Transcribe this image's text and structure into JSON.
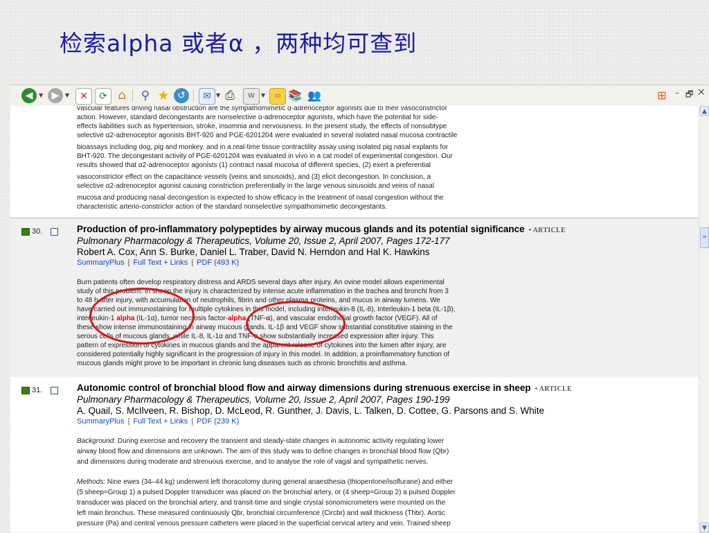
{
  "slide_title": "检索alpha 或者α ，两种均可查到",
  "toolbar": {
    "icons": [
      "back-icon",
      "forward-icon",
      "stop-icon",
      "refresh-icon",
      "home-icon",
      "search-icon",
      "favorites-icon",
      "history-icon",
      "mail-icon",
      "print-icon",
      "edit-icon",
      "discuss-icon",
      "research-icon",
      "messenger-icon"
    ],
    "window_controls": {
      "minimize": "–",
      "restore": "🗗",
      "close": "×"
    }
  },
  "prev_abstract_lines": [
    "vascular features driving nasal obstruction are the sympathomimetic α-adrenoceptor agonists due to their vasoconstrictor",
    "action. However, standard decongestants are nonselective α-adrenoceptor agonists, which have the potential for side-",
    "effects liabilities such as hypertension, stroke, insomnia and nervousness. In the present study, the effects of nonsubtype",
    "selective α2-adrenoceptor agonists BHT-920 and PGE-6201204 were evaluated in several isolated nasal mucosa contractile",
    "bioassays including dog, pig and monkey, and in a real-time tissue contractility assay using isolated pig nasal explants for",
    "BHT-920. The decongestant activity of PGE-6201204 was evaluated in vivo in a cat model of experimental congestion. Our",
    "results showed that α2-adrenoceptor agonists (1) contract nasal mucosa of different species, (2) exert a preferential",
    "vasoconstrictor effect on the capacitance vessels (veins and sinusoids), and (3) elicit decongestion. In conclusion, a",
    "selective α2-adrenoceptor agonist causing constriction preferentially in the large venous sinusoids and veins of nasal",
    "mucosa and producing nasal decongestion is expected to show efficacy in the treatment of nasal congestion without the",
    "characteristic arterio-constrictor action of the standard nonselective sympathomimetic decongestants."
  ],
  "records": [
    {
      "number": "30.",
      "title": "Production of pro-inflammatory polypeptides by airway mucous glands and its potential significance",
      "type": "• ARTICLE",
      "journal": "Pulmonary Pharmacology & Therapeutics, Volume 20, Issue 2, April 2007, Pages 172-177",
      "authors": "Robert A. Cox, Ann S. Burke, Daniel L. Traber, David N. Herndon and Hal K. Hawkins",
      "links": [
        "SummaryPlus",
        "Full Text + Links",
        "PDF (493 K)"
      ],
      "abstract_lines": [
        "Burn patients often develop respiratory distress and ARDS several days after injury. An ovine model allows experimental",
        "study of this problem. In sheep the injury is characterized by intense acute inflammation in the trachea and bronchi from 3",
        "to 48 h after injury, with accumulation of neutrophils, fibrin and other plasma proteins, and mucus in airway lumens. We",
        "have carried out immunostaining for multiple cytokines in this model, including interleukin-8 (IL-8), Interleukin-1 beta (IL-1β),",
        [
          "interleukin-1 ",
          "alpha",
          " (IL-1α), tumor necrosis factor-",
          "alpha",
          " (TNF-",
          "α",
          "), and vascular endothelial growth factor (VEGF). All of"
        ],
        "these show intense immunostaining in airway mucous glands. IL-1β and VEGF show substantial constitutive staining in the",
        "serous cells of mucous glands, while IL-8, IL-1α and TNF-α show substantially increased expression after injury. This",
        "pattern of expression of cytokines in mucous glands and the apparent release of cytokines into the lumen after injury, are",
        "considered potentially highly significant in the progression of injury in this model. In addition, a proinflammatory function of",
        "mucous glands might prove to be important in chronic lung diseases such as chronic bronchitis and asthma."
      ]
    },
    {
      "number": "31.",
      "title": "Autonomic control of bronchial blood flow and airway dimensions during strenuous exercise in sheep",
      "type": "• ARTICLE",
      "journal": "Pulmonary Pharmacology & Therapeutics, Volume 20, Issue 2, April 2007, Pages 190-199",
      "authors": "A. Quail, S. McIlveen, R. Bishop, D. McLeod, R. Gunther, J. Davis, L. Talken, D. Cottee, G. Parsons and S. White",
      "links": [
        "SummaryPlus",
        "Full Text + Links",
        "PDF (239 K)"
      ],
      "background_label": "Background:",
      "background_lines": [
        " During exercise and recovery the transient and steady-state changes in autonomic activity regulating lower",
        "airway blood flow and dimensions are unknown. The aim of this study was to define changes in bronchial blood flow (Qbr)",
        "and dimensions during moderate and strenuous exercise, and to analyse the role of vagal and sympathetic nerves."
      ],
      "methods_label": "Methods:",
      "methods_lines": [
        " Nine ewes (34–44 kg) underwent left thoracotomy during general anaesthesia (thiopentone/isoflurane) and either",
        "(5 sheep=Group 1) a pulsed Doppler transducer was placed on the bronchial artery, or (4 sheep=Group 2) a pulsed Doppler",
        "transducer was placed on the bronchial artery, and transit-time and single crystal sonomicrometers were mounted on the",
        "left main bronchus. These measured continuously Qbr, bronchial circumference (Circbr) and wall thickness (Thbr). Aortic",
        "pressure (Pa) and central venous pressure catheters were placed in the superficial cervical artery and vein. Trained sheep"
      ]
    }
  ]
}
